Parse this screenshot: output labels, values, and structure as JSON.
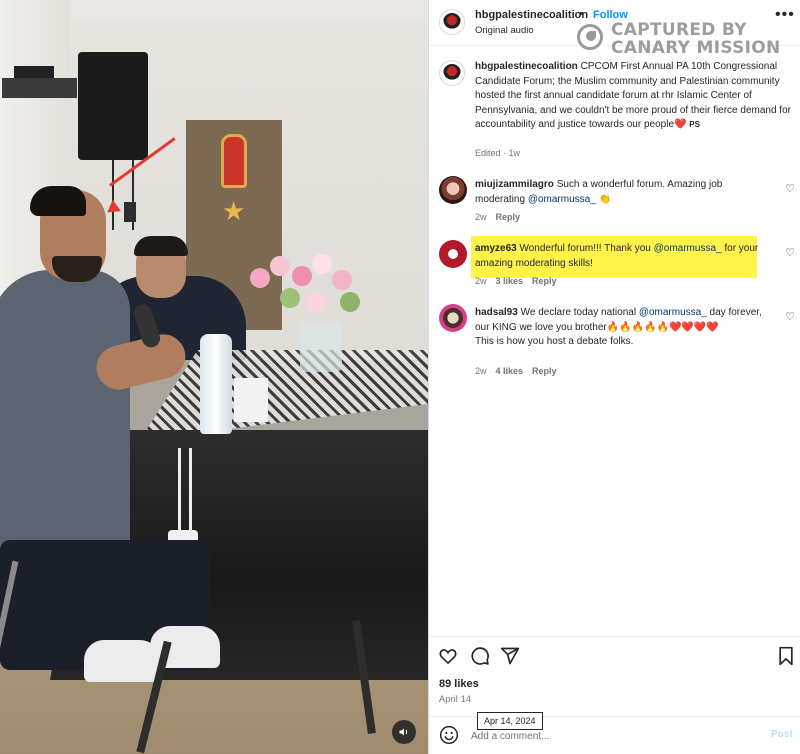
{
  "post": {
    "username": "hbgpalestinecoalition",
    "follow_label": "Follow",
    "audio": "Original audio",
    "caption": "CPCOM First Annual PA 10th Congressional Candidate Forum; the Muslim community and Palestinian community hosted the first annual candidate forum at rhr Islamic Center of Pennsylvania, and we couldn't be more proud of their fierce demand for accountability and justice towards our people",
    "caption_suffix": "PS",
    "caption_meta": "Edited · 1w"
  },
  "watermark": {
    "line1": "CAPTURED BY",
    "line2": "CANARY MISSION"
  },
  "comments": [
    {
      "username": "miujizammilagro",
      "text_before": "Such a wonderful forum. Amazing job moderating ",
      "mention": "@omarmussa_",
      "text_after": " 👏",
      "age": "2w",
      "likes": "",
      "reply": "Reply"
    },
    {
      "username": "amyze63",
      "text_before": "Wonderful forum!!! Thank you ",
      "mention": "@omarmussa_",
      "text_after": " for your amazing moderating skills!",
      "age": "2w",
      "likes": "3 likes",
      "reply": "Reply",
      "highlighted": true
    },
    {
      "username": "hadsal93",
      "text_before": "We declare today national ",
      "mention": "@omarmussa_",
      "text_after": " day forever, our KING we love you brother🔥🔥🔥🔥🔥❤️❤️❤️❤️",
      "line2": "This is how you host a debate folks.",
      "age": "2w",
      "likes": "4 likes",
      "reply": "Reply"
    }
  ],
  "stats": {
    "likes": "89 likes",
    "date": "April 14",
    "tooltip": "Apr 14, 2024"
  },
  "composer": {
    "placeholder": "Add a comment...",
    "post_label": "Post"
  },
  "colors": {
    "follow": "#0095f6",
    "highlight": "#fff34a",
    "heart": "#e0245e",
    "arrow": "#e53935",
    "watermark": "#8d8d8d"
  },
  "icons": [
    "more-icon",
    "like-icon",
    "comment-icon",
    "share-icon",
    "bookmark-icon",
    "heart-icon",
    "emoji-icon",
    "volume-icon"
  ]
}
